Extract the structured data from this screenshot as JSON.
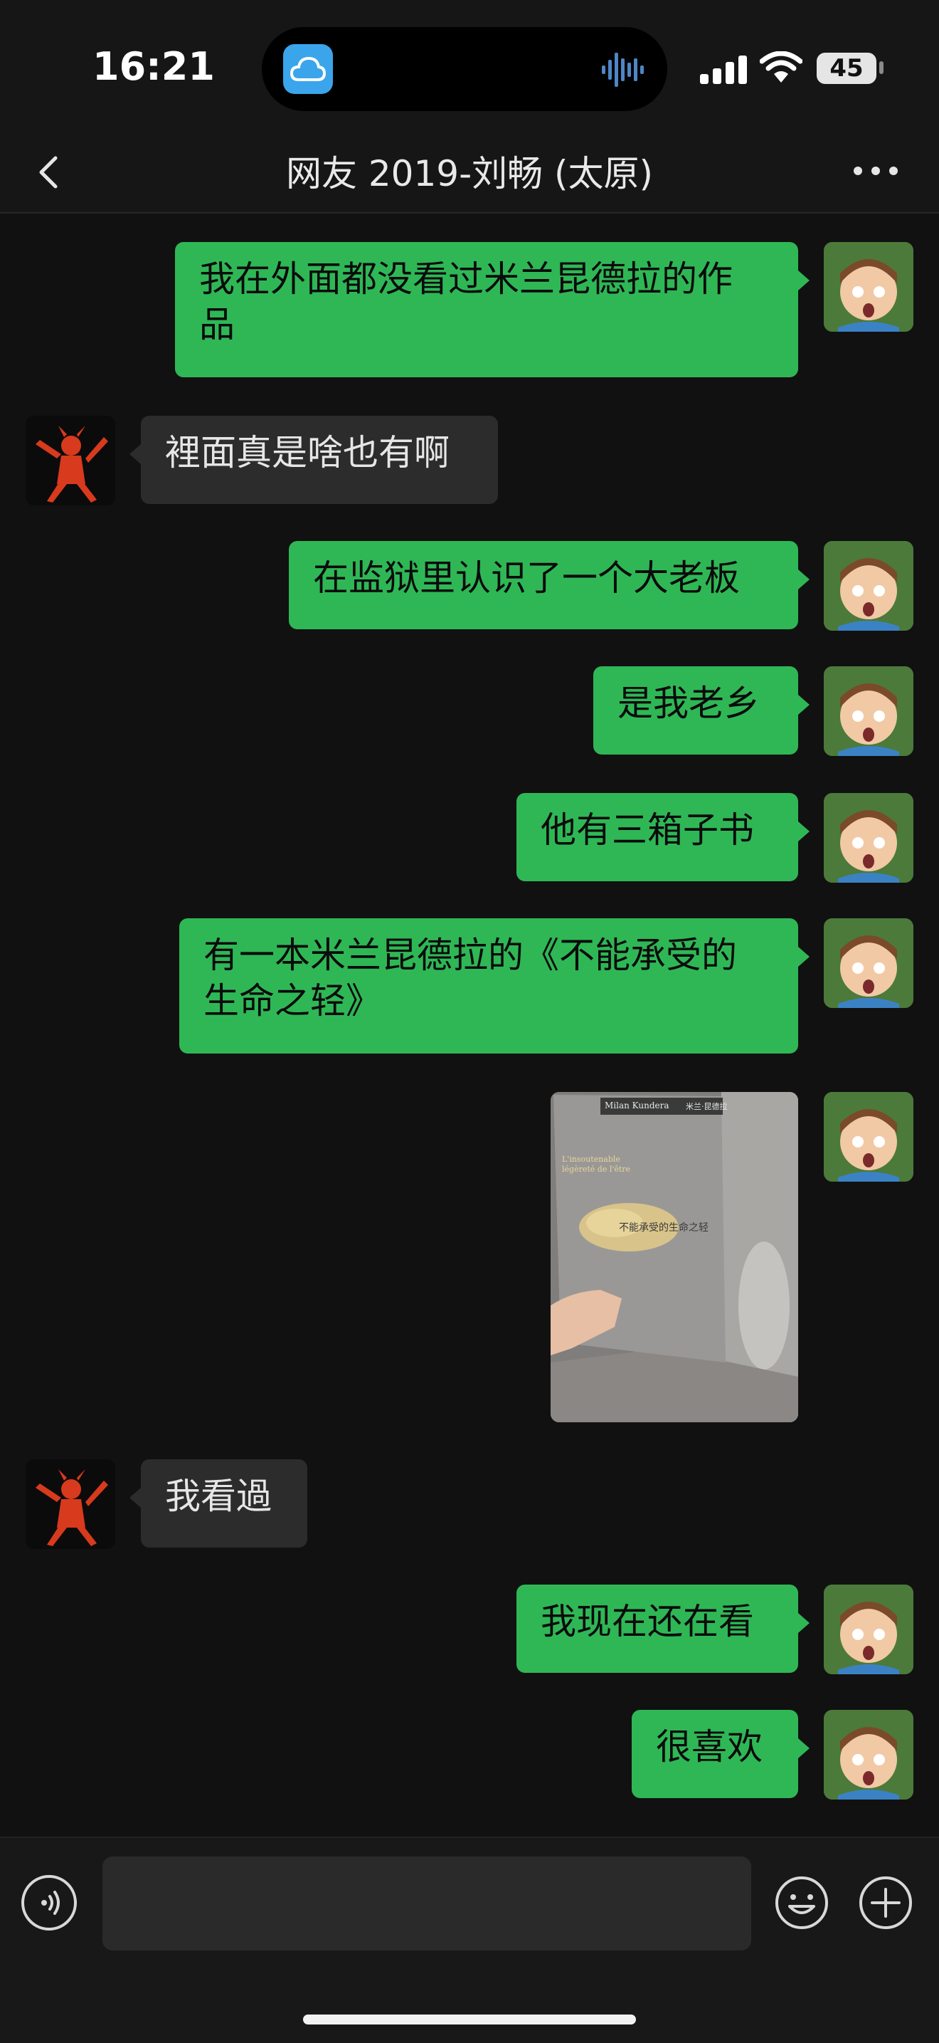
{
  "status_bar": {
    "time": "16:21",
    "battery": "45"
  },
  "header": {
    "title": "网友 2019-刘畅 (太原)"
  },
  "messages": [
    {
      "sender": "me",
      "text": "我在外面都没看过米兰昆德拉的作\n品"
    },
    {
      "sender": "them",
      "text": "裡面真是啥也有啊"
    },
    {
      "sender": "me",
      "text": "在监狱里认识了一个大老板"
    },
    {
      "sender": "me",
      "text": "是我老乡"
    },
    {
      "sender": "me",
      "text": "他有三箱子书"
    },
    {
      "sender": "me",
      "text": "有一本米兰昆德拉的《不能承受的\n生命之轻》"
    },
    {
      "sender": "me",
      "type": "image",
      "book": {
        "author": "Milan Kundera",
        "author_cn": "米兰·昆德拉",
        "title_fr": "L'insoutenable légèreté de l'être",
        "title_cn": "不能承受的生命之轻"
      }
    },
    {
      "sender": "them",
      "text": "我看過"
    },
    {
      "sender": "me",
      "text": "我现在还在看"
    },
    {
      "sender": "me",
      "text": "很喜欢"
    }
  ],
  "input": {
    "placeholder": ""
  },
  "icons": {
    "back": "chevron-left-icon",
    "more": "ellipsis-icon",
    "voice": "voice-icon",
    "emoji": "smiley-icon",
    "plus": "plus-icon"
  },
  "colors": {
    "my_bubble": "#2fb756",
    "their_bubble": "#2c2c2c",
    "background": "#111111"
  }
}
